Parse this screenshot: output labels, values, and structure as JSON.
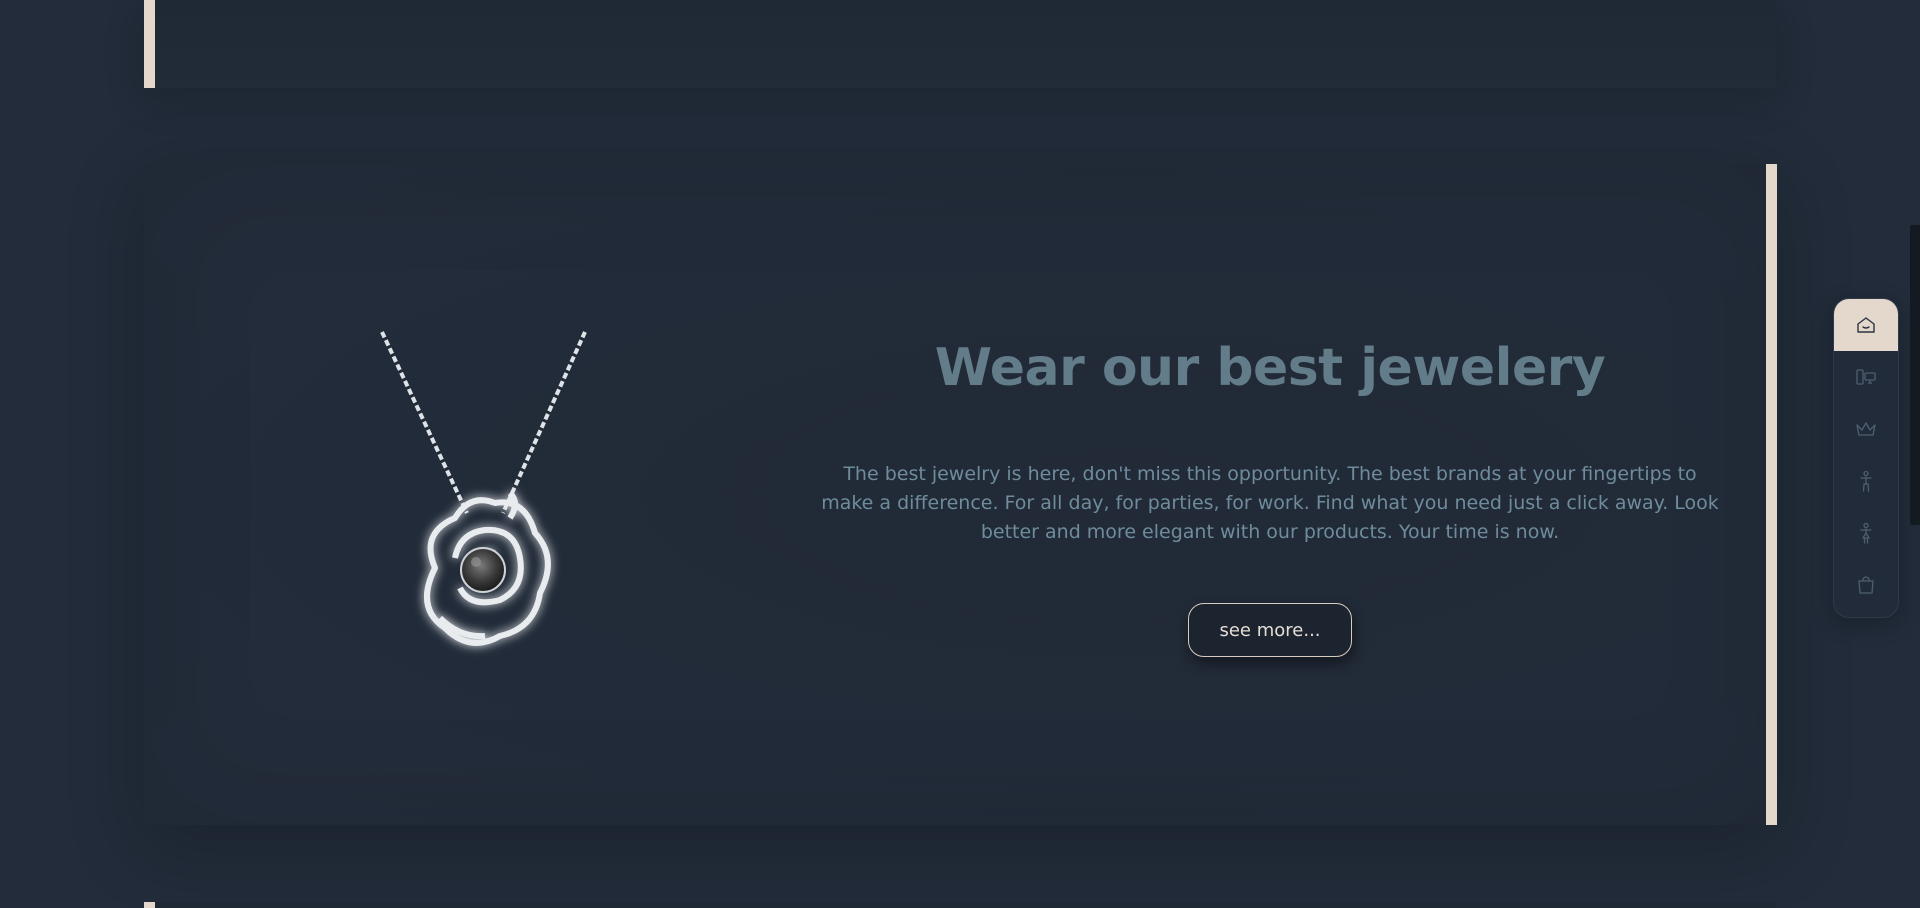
{
  "hero": {
    "title": "Wear our best jewelery",
    "description": "The best jewelry is here, don't miss this opportunity. The best brands at your fingertips to make a difference. For all day, for parties, for work. Find what you need just a click away. Look better and more elegant with our products. Your time is now.",
    "button_label": "see more...",
    "image_subject": "rose-pendant-necklace"
  },
  "nav": {
    "items": [
      {
        "icon": "home-icon",
        "active": true
      },
      {
        "icon": "devices-icon",
        "active": false
      },
      {
        "icon": "crown-icon",
        "active": false
      },
      {
        "icon": "man-icon",
        "active": false
      },
      {
        "icon": "woman-icon",
        "active": false
      },
      {
        "icon": "shopping-bag-icon",
        "active": false
      }
    ]
  },
  "colors": {
    "background": "#222c3a",
    "accent": "#e4d7cc",
    "title": "#637c89",
    "text": "#6f8c9c",
    "nav_icon": "#4d6070"
  }
}
